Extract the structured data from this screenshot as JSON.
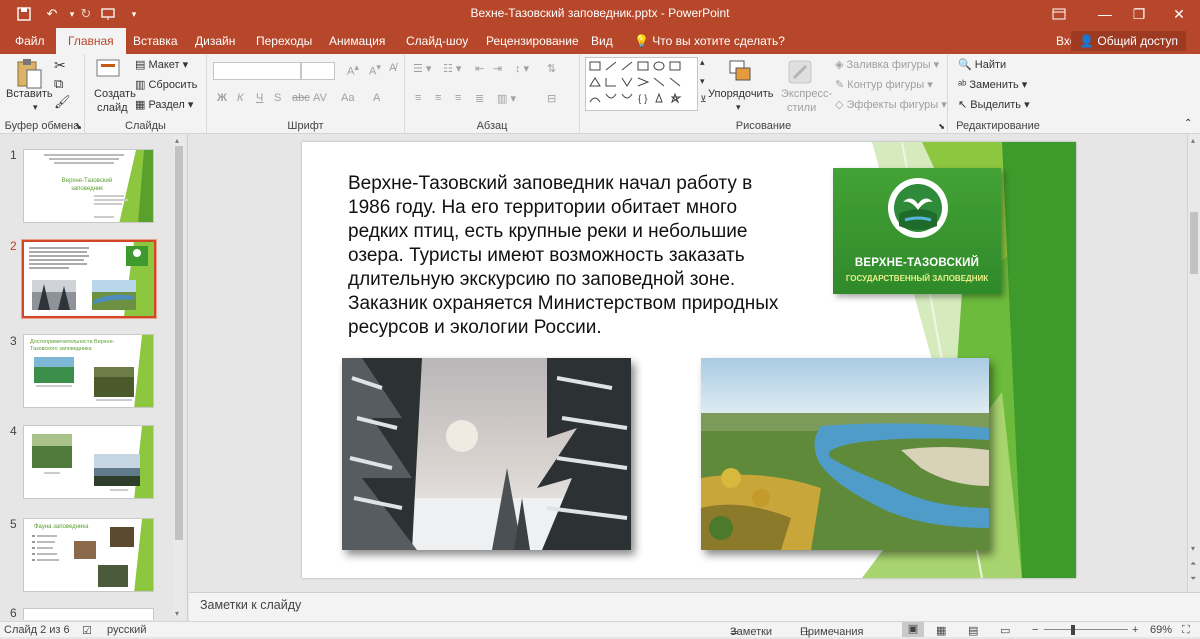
{
  "window": {
    "title": "Вехне-Тазовский заповедник.pptx - PowerPoint",
    "login": "Вход",
    "share": "Общий доступ"
  },
  "tabs": [
    "Файл",
    "Главная",
    "Вставка",
    "Дизайн",
    "Переходы",
    "Анимация",
    "Слайд-шоу",
    "Рецензирование",
    "Вид"
  ],
  "tell_me": "Что вы хотите сделать?",
  "ribbon": {
    "clipboard": {
      "group": "Буфер обмена",
      "paste": "Вставить"
    },
    "slides": {
      "group": "Слайды",
      "new_slide_1": "Создать",
      "new_slide_2": "слайд",
      "layout": "Макет",
      "reset": "Сбросить",
      "section": "Раздел"
    },
    "font": {
      "group": "Шрифт",
      "bold": "Ж",
      "italic": "К",
      "underline": "Ч",
      "strike": "S",
      "abc": "abc",
      "spacing": "AV",
      "case": "Aa"
    },
    "paragraph": {
      "group": "Абзац"
    },
    "drawing": {
      "group": "Рисование",
      "arrange": "Упорядочить",
      "quick_styles_1": "Экспресс-",
      "quick_styles_2": "стили",
      "fill": "Заливка фигуры",
      "outline": "Контур фигуры",
      "effects": "Эффекты фигуры"
    },
    "editing": {
      "group": "Редактирование",
      "find": "Найти",
      "replace": "Заменить",
      "select": "Выделить"
    }
  },
  "thumbnails": [
    {
      "num": "1",
      "title": "Верхне-Тазовский заповедник"
    },
    {
      "num": "2"
    },
    {
      "num": "3",
      "title": "Достопримечательности Верхне-Тазовского заповедника"
    },
    {
      "num": "4"
    },
    {
      "num": "5",
      "title": "Фауна заповедника"
    },
    {
      "num": "6"
    }
  ],
  "slide": {
    "body": "Верхне-Тазовский заповедник начал работу в 1986 году. На его территории обитает много редких птиц, есть крупные реки и небольшие озера. Туристы имеют возможность заказать длительную экскурсию по заповедной зоне. Заказник охраняется Министерством природных ресурсов и экологии России.",
    "logo_line1": "ВЕРХНЕ-ТАЗОВСКИЙ",
    "logo_line2": "ГОСУДАРСТВЕННЫЙ ЗАПОВЕДНИК"
  },
  "notes_placeholder": "Заметки к слайду",
  "status": {
    "slide_counter": "Слайд 2 из 6",
    "language": "русский",
    "notes": "Заметки",
    "comments": "Примечания",
    "zoom": "69%"
  },
  "colors": {
    "accent": "#b7472a",
    "slide_green": "#6cbb3c",
    "selected_thumb": "#d24726"
  }
}
